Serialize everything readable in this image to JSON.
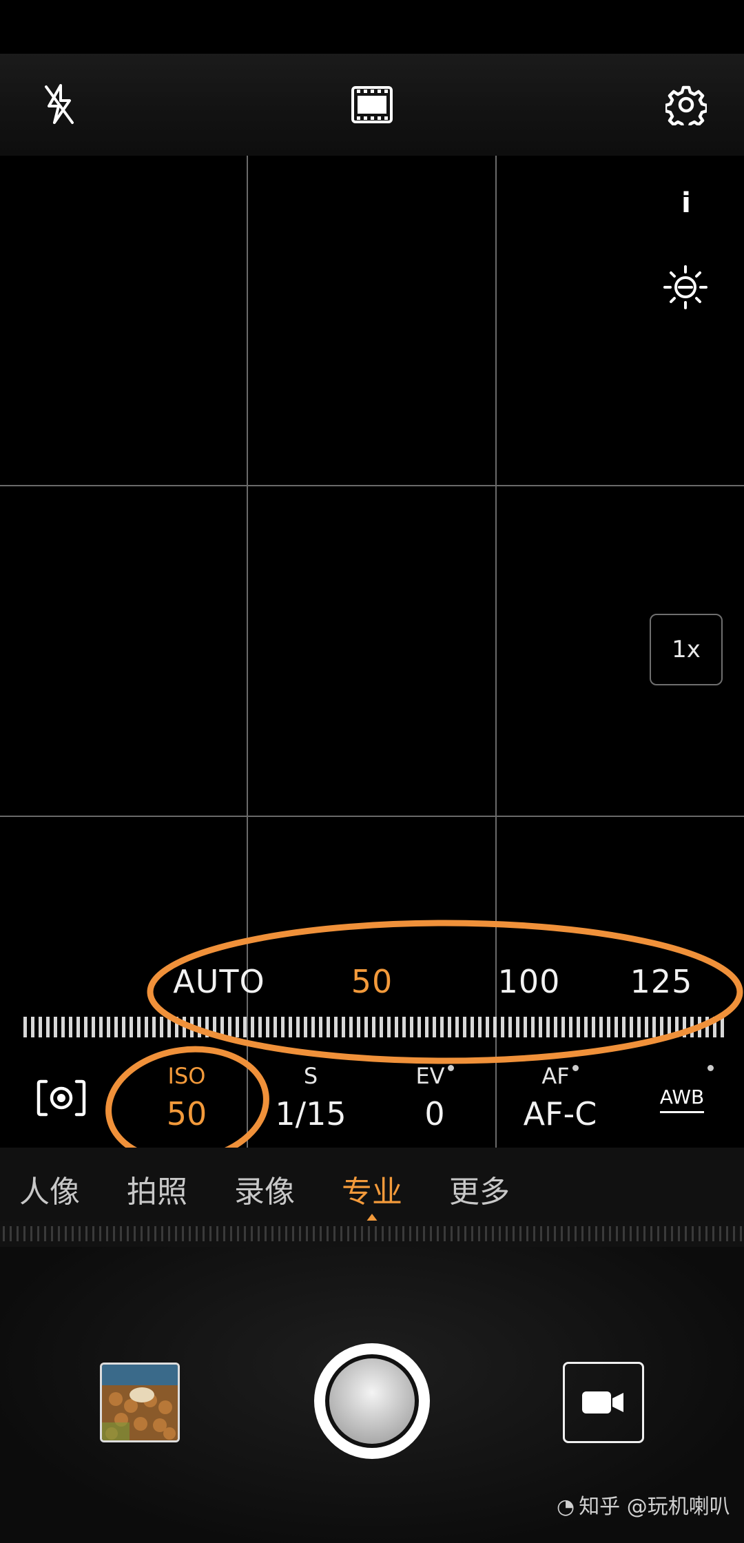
{
  "colors": {
    "accent": "#F39A3B",
    "highlight_ring": "#F0913A"
  },
  "top_bar": {
    "icons": [
      "flash-off-icon",
      "filmstrip-icon",
      "gear-icon"
    ]
  },
  "side_controls": {
    "info_label": "i",
    "zoom_label": "1x"
  },
  "iso_scale": {
    "values": [
      "AUTO",
      "50",
      "100",
      "125"
    ],
    "selected": "50"
  },
  "params": {
    "metering": {
      "icon": "metering-icon"
    },
    "iso": {
      "label": "ISO",
      "value": "50"
    },
    "shutter": {
      "label": "S",
      "value": "1/15"
    },
    "ev": {
      "label": "EV",
      "value": "0"
    },
    "af": {
      "label": "AF",
      "value": "AF-C"
    },
    "wb": {
      "label": "AWB"
    }
  },
  "modes": {
    "items": [
      "人像",
      "拍照",
      "录像",
      "专业",
      "更多"
    ],
    "active": "专业"
  },
  "watermark": "知乎 @玩机喇叭"
}
